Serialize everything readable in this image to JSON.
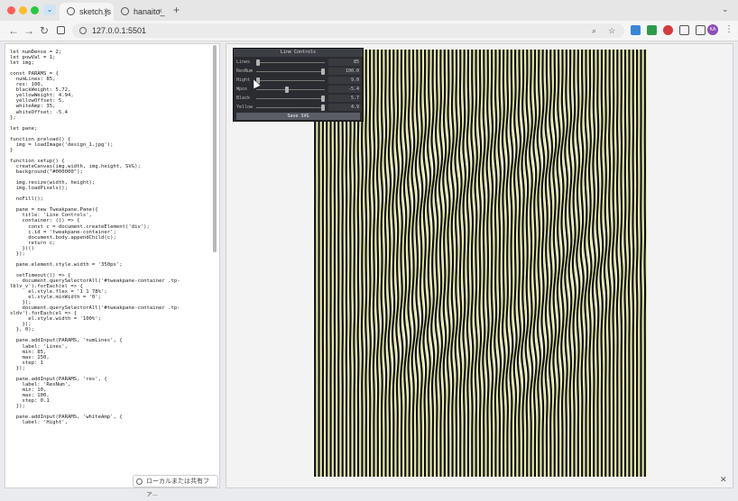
{
  "tabs": [
    {
      "label": "sketch.js",
      "active": true
    },
    {
      "label": "hanaito_",
      "active": false
    }
  ],
  "new_tab_label": "+",
  "address_bar": {
    "url": "127.0.0.1:5501"
  },
  "profile_initials": "KA",
  "code_lines": [
    "let numDense = 2;",
    "let powVal = 1;",
    "let img;",
    "",
    "const PARAMS = {",
    "  numLines: 85,",
    "  res: 100,",
    "  blackWeight: 5.72,",
    "  yellowWeight: 4.94,",
    "  yellowOffset: 5,",
    "  whiteAmp: 35,",
    "  whiteOffset: -5.4",
    "};",
    "",
    "let pane;",
    "",
    "function preload() {",
    "  img = loadImage('design_1.jpg');",
    "}",
    "",
    "function setup() {",
    "  createCanvas(img.width, img.height, SVG);",
    "  background(\"#000000\");",
    "",
    "  img.resize(width, height);",
    "  img.loadPixels();",
    "",
    "  noFill();",
    "",
    "  pane = new Tweakpane.Pane({",
    "    title: 'Line Controls',",
    "    container: (() => {",
    "      const c = document.createElement('div');",
    "      c.id = 'tweakpane-container';",
    "      document.body.appendChild(c);",
    "      return c;",
    "    })()",
    "  });",
    "",
    "  pane.element.style.width = '350px';",
    "",
    "  setTimeout(() => {",
    "    document.querySelectorAll('#tweakpane-container .tp-",
    "lblv_v').forEach(el => {",
    "      el.style.flex = '1 1 78%';",
    "      el.style.minWidth = '0';",
    "    });",
    "    document.querySelectorAll('#tweakpane-container .tp-",
    "sldv').forEach(el => {",
    "      el.style.width = '100%';",
    "    });",
    "  }, 0);",
    "",
    "  pane.addInput(PARAMS, 'numLines', {",
    "    label: 'Lines',",
    "    min: 85,",
    "    max: 150,",
    "    step: 1",
    "  });",
    "",
    "  pane.addInput(PARAMS, 'res', {",
    "    label: 'ResNum',",
    "    min: 10,",
    "    max: 100,",
    "    step: 0.1",
    "  });",
    "",
    "  pane.addInput(PARAMS, 'whiteAmp', {",
    "    label: 'Hight',"
  ],
  "pane": {
    "title": "Line Controls",
    "controls": [
      {
        "label": "Lines",
        "value": "85",
        "level": 0.0
      },
      {
        "label": "ResNum",
        "value": "100.0",
        "level": 1.0
      },
      {
        "label": "Hight",
        "value": "9.0",
        "level": 0.0
      },
      {
        "label": "Wpos",
        "value": "-5.4",
        "level": 0.45
      },
      {
        "label": "Black",
        "value": "5.7",
        "level": 1.0
      },
      {
        "label": "Yellow",
        "value": "4.9",
        "level": 1.0
      }
    ],
    "save_button": "Save SVG"
  },
  "status_text": "ローカルまたは共有ファ..."
}
